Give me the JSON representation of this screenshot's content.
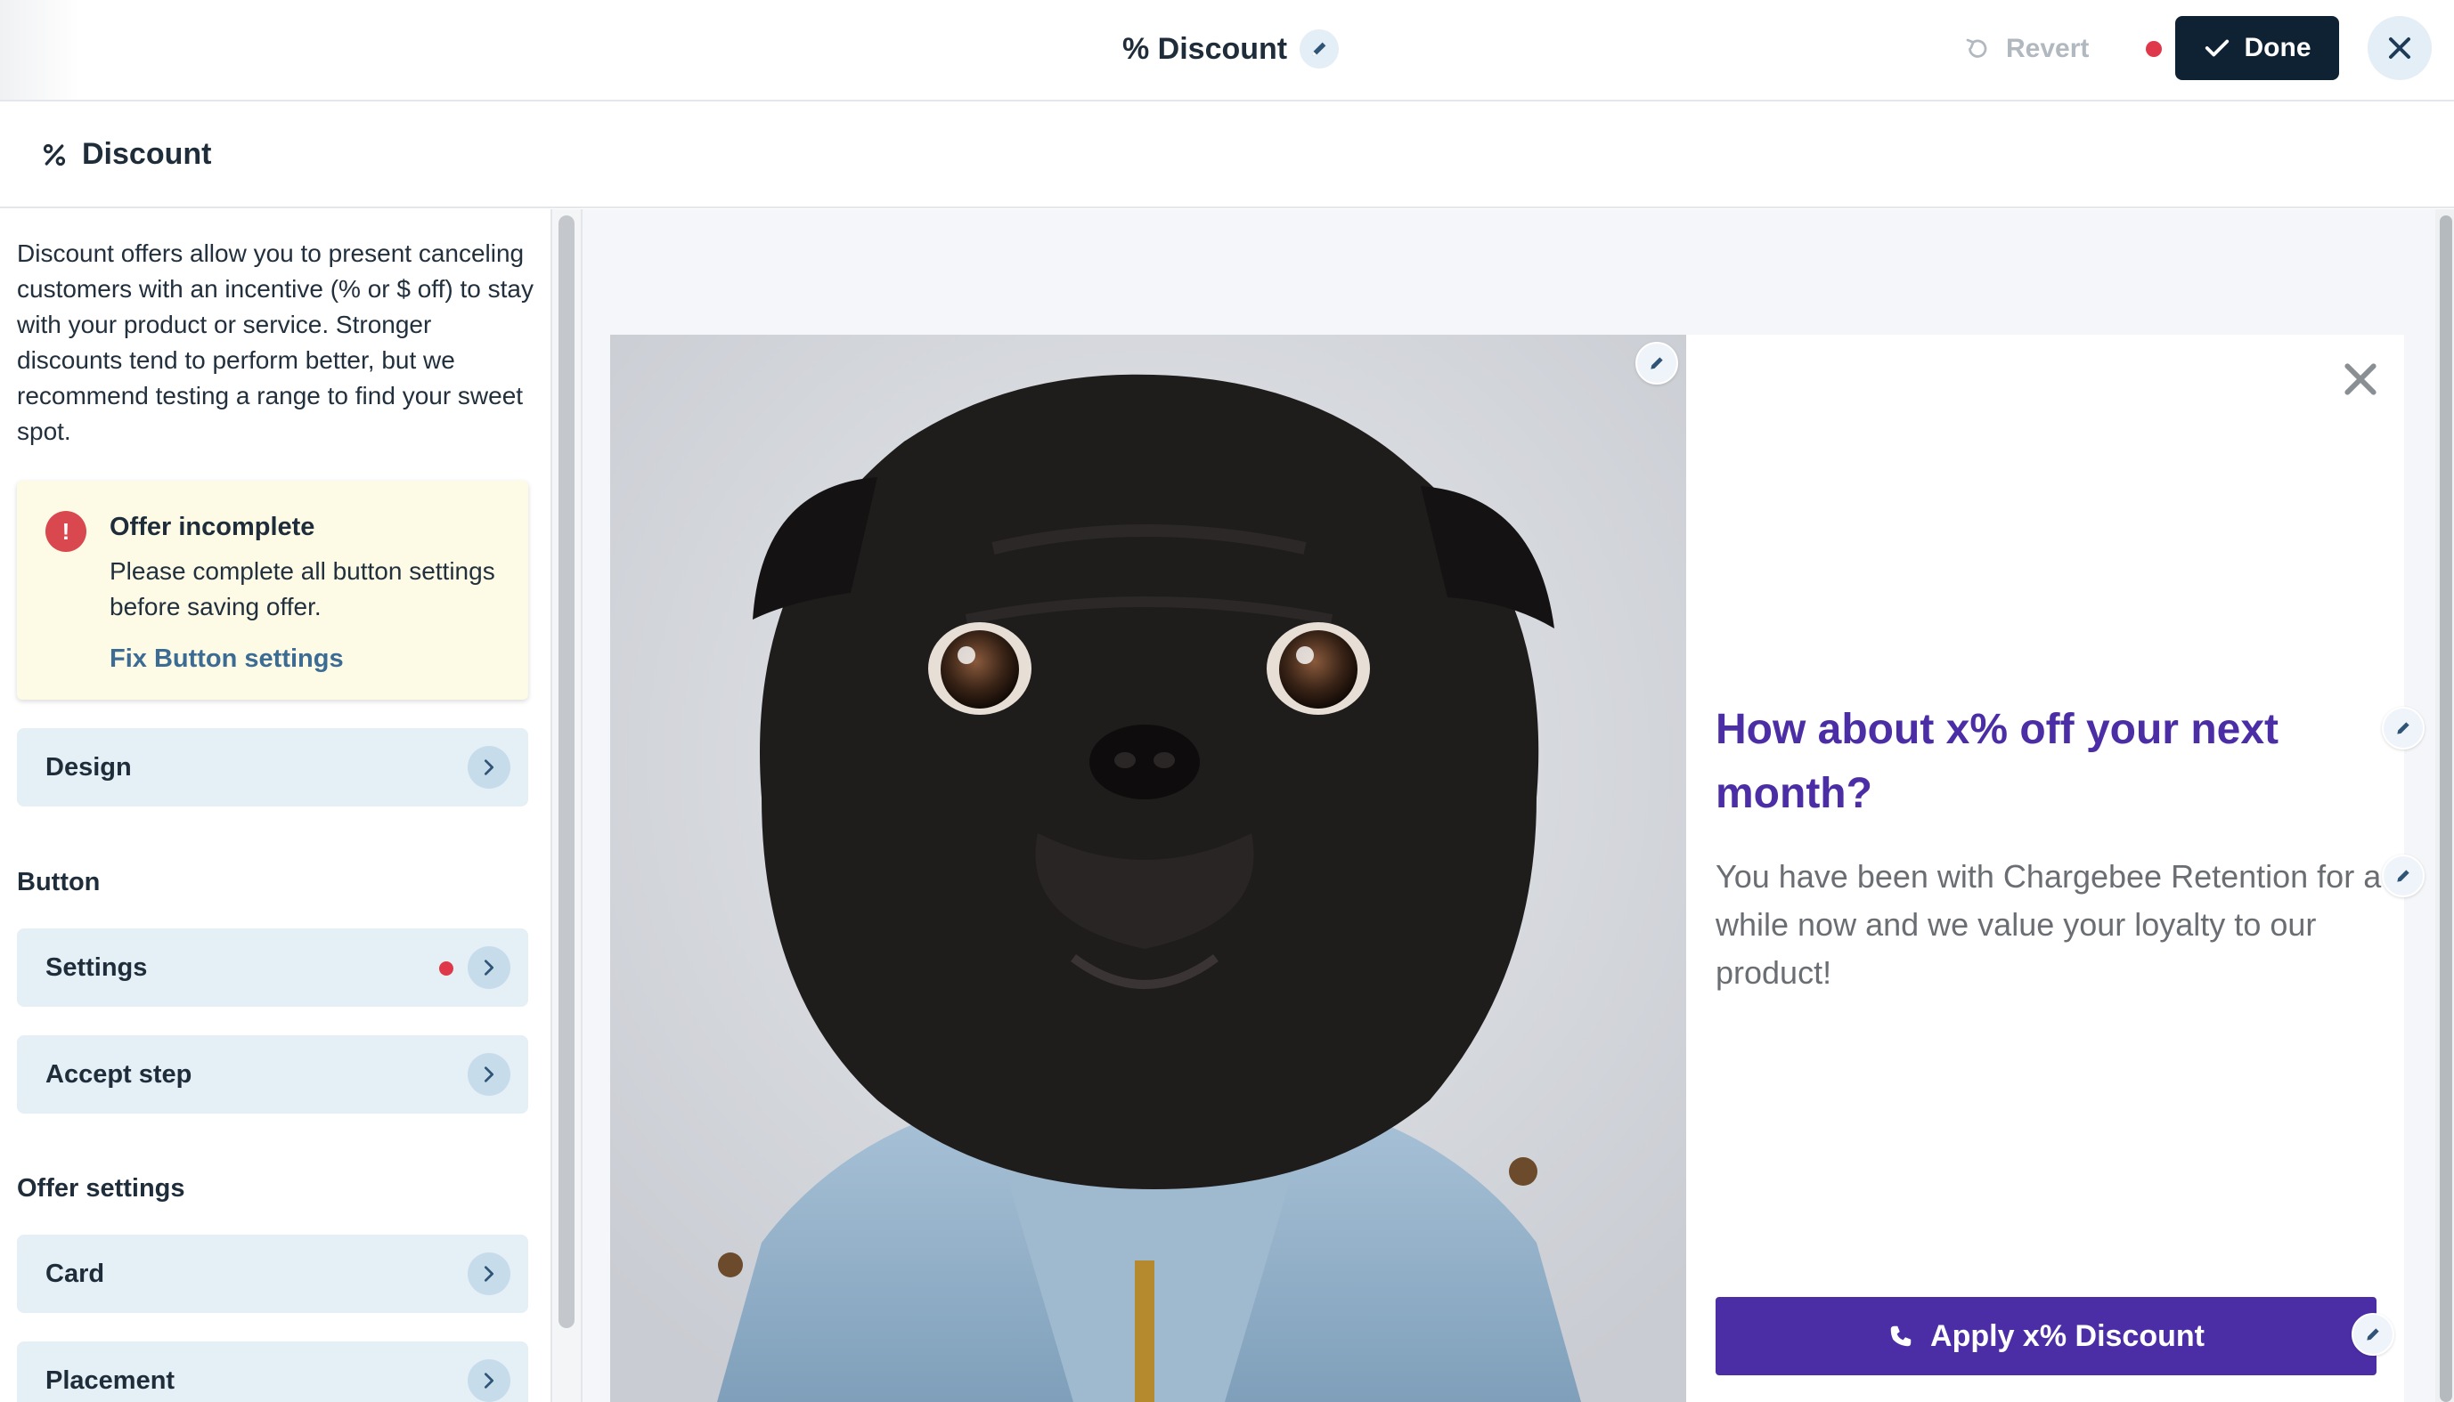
{
  "topbar": {
    "title": "% Discount",
    "revert_label": "Revert",
    "done_label": "Done"
  },
  "section": {
    "title": "Discount"
  },
  "sidebar": {
    "description": "Discount offers allow you to present canceling customers with an incentive (% or $ off) to stay with your product or service. Stronger discounts tend to perform better, but we recommend testing a range to find your sweet spot.",
    "alert": {
      "icon": "!",
      "title": "Offer incomplete",
      "body": "Please complete all button settings before saving offer.",
      "link": "Fix Button settings"
    },
    "items": {
      "design": "Design",
      "button_group": "Button",
      "settings": "Settings",
      "accept_step": "Accept step",
      "offer_group": "Offer settings",
      "card": "Card",
      "placement": "Placement"
    }
  },
  "preview": {
    "headline": "How about x% off your next month?",
    "body": "You have been with Chargebee Retention for a while now and we value your loyalty to our product!",
    "cta_label": "Apply x% Discount"
  },
  "colors": {
    "brand_purple": "#4b2ea6",
    "done_dark": "#0f2233",
    "unsaved_red": "#e0384b",
    "nav_bg": "#e4eff6",
    "alert_bg": "#fdfbe6"
  },
  "icons": [
    "pencil-icon",
    "revert-icon",
    "check-icon",
    "close-icon",
    "percent-icon",
    "alert-icon",
    "chevron-right-icon",
    "phone-icon"
  ]
}
